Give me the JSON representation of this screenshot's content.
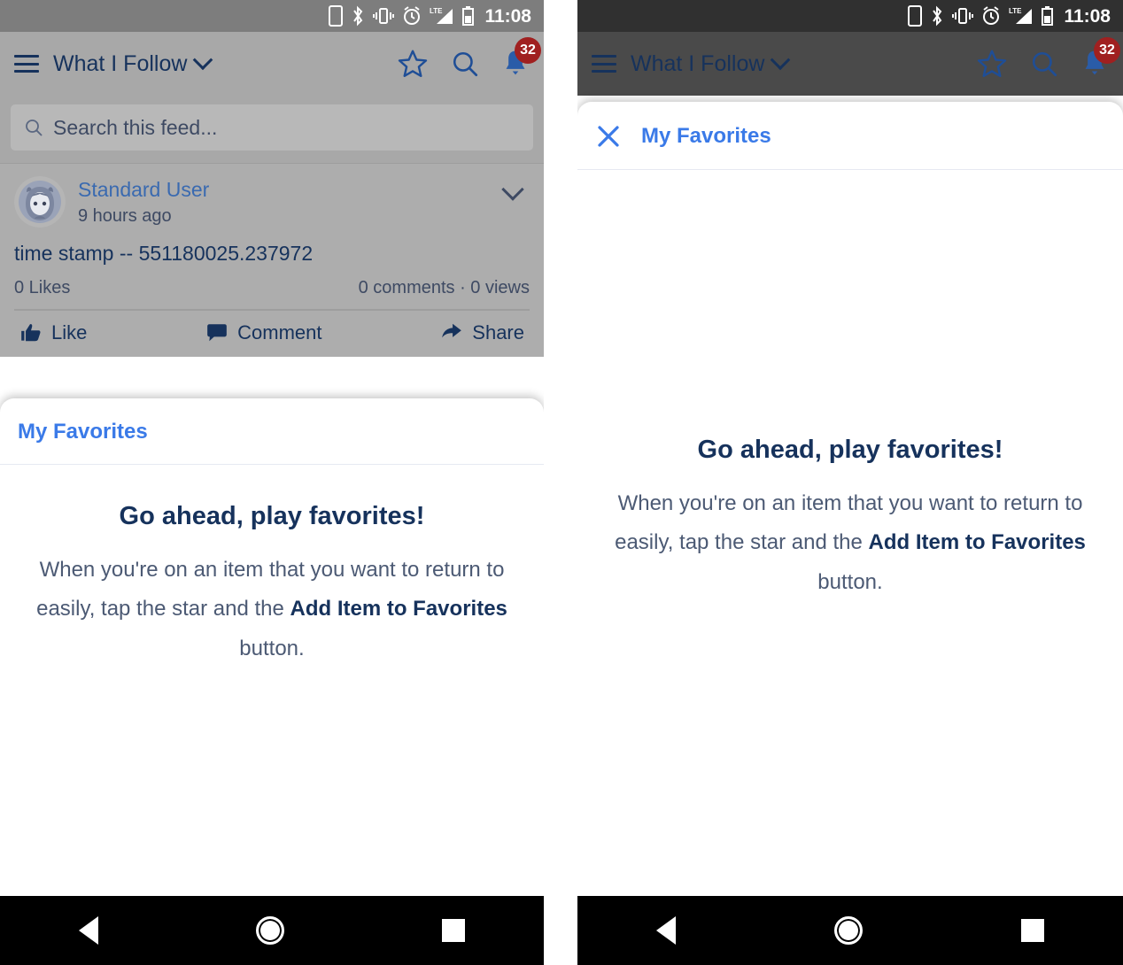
{
  "status_bar": {
    "time": "11:08",
    "icons": [
      "portrait-lock-icon",
      "bluetooth-icon",
      "vibrate-icon",
      "alarm-icon",
      "lte-signal-icon",
      "battery-icon"
    ]
  },
  "app_header": {
    "menu_icon": "hamburger-icon",
    "title": "What I Follow",
    "dropdown_icon": "chevron-down-icon",
    "favorites_icon": "star-outline-icon",
    "search_icon": "search-icon",
    "notifications_icon": "bell-icon",
    "notification_count": "32"
  },
  "feed": {
    "search": {
      "placeholder": "Search this feed...",
      "value": "",
      "icon": "search-icon"
    },
    "post": {
      "author": "Standard User",
      "timestamp": "9 hours ago",
      "body": "time stamp -- 551180025.237972",
      "likes": "0 Likes",
      "engagement": "0 comments · 0 views",
      "menu_icon": "chevron-down-icon",
      "actions": [
        {
          "label": "Like",
          "icon": "thumbs-up-icon"
        },
        {
          "label": "Comment",
          "icon": "comment-bubble-icon"
        },
        {
          "label": "Share",
          "icon": "share-arrow-icon"
        }
      ]
    }
  },
  "favorites_button": {
    "label": "Add Item to Favorites"
  },
  "favorites_sheet": {
    "close_icon": "close-x-icon",
    "title": "My Favorites",
    "empty_state": {
      "heading": "Go ahead, play favorites!",
      "body_prefix": "When you're on an item that you want to return to easily, tap the star and the ",
      "body_emphasis": "Add Item to Favorites",
      "body_suffix": " button."
    }
  },
  "nav_bar": {
    "back": "back-triangle-icon",
    "home": "home-circle-icon",
    "recents": "recents-square-icon"
  },
  "colors": {
    "brand_blue": "#3a7ae8",
    "navy": "#16325c",
    "link_blue": "#3a6ab0",
    "badge_red": "#a02020",
    "scrim_gray": "#a8a8a8",
    "scrim_dark": "#4a4a4a"
  }
}
